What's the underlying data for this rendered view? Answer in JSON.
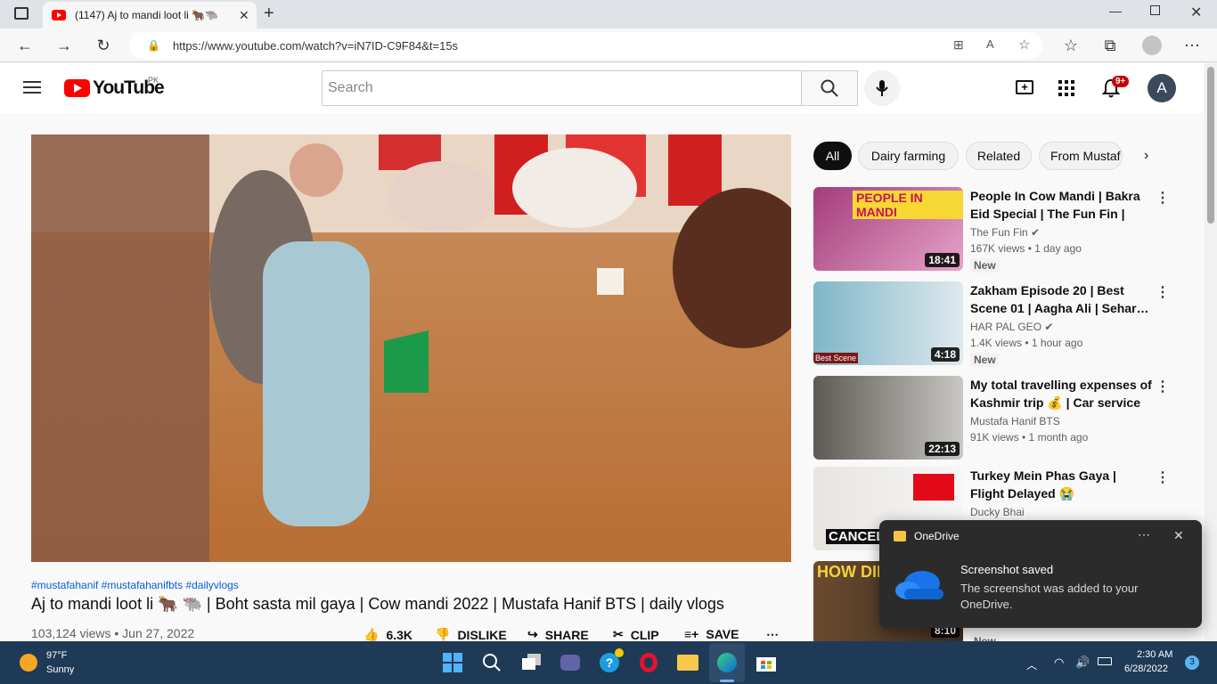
{
  "browser": {
    "tab_title": "(1147) Aj to mandi loot li 🐂🐃",
    "url": "https://www.youtube.com/watch?v=iN7ID-C9F84&t=15s"
  },
  "youtube": {
    "logo_text": "YouTube",
    "country": "PK",
    "search_placeholder": "Search",
    "notification_count": "9+",
    "avatar_letter": "A"
  },
  "video": {
    "hashtags": "#mustafahanif #mustafahanifbts #dailyvlogs",
    "title": "Aj to mandi loot li 🐂 🐃  | Boht sasta mil gaya | Cow mandi 2022 | Mustafa Hanif BTS | daily vlogs",
    "views_date": "103,124 views • Jun 27, 2022",
    "likes": "6.3K",
    "dislike": "DISLIKE",
    "share": "SHARE",
    "clip": "CLIP",
    "save": "SAVE"
  },
  "chips": [
    "All",
    "Dairy farming",
    "Related",
    "From Mustaf"
  ],
  "recommendations": [
    {
      "title": "People In Cow Mandi | Bakra Eid Special | The Fun Fin | Comedy…",
      "channel": "The Fun Fin",
      "views": "167K views • 1 day ago",
      "duration": "18:41",
      "badge": "New",
      "thumb_text": "PEOPLE IN MANDI"
    },
    {
      "title": "Zakham Episode 20 | Best Scene 01 | Aagha Ali | Sehar…",
      "channel": "HAR PAL GEO",
      "views": "1.4K views • 1 hour ago",
      "duration": "4:18",
      "badge": "New",
      "thumb_text": "Best Scene"
    },
    {
      "title": "My total travelling expenses of Kashmir trip 💰 | Car service |…",
      "channel": "Mustafa Hanif BTS",
      "views": "91K views • 1 month ago",
      "duration": "22:13",
      "badge": "",
      "thumb_text": ""
    },
    {
      "title": "Turkey Mein Phas Gaya | Flight Delayed 😭",
      "channel": "Ducky Bhai",
      "views": "",
      "duration": "",
      "badge": "",
      "thumb_text": "CANCEL"
    },
    {
      "title": "",
      "channel": "",
      "views": "",
      "duration": "8:10",
      "badge": "New",
      "thumb_text": "HOW DID"
    }
  ],
  "toast": {
    "app": "OneDrive",
    "heading": "Screenshot saved",
    "body": "The screenshot was added to your OneDrive."
  },
  "taskbar": {
    "temp": "97°F",
    "weather": "Sunny",
    "time": "2:30 AM",
    "date": "6/28/2022",
    "notif_count": "3"
  }
}
